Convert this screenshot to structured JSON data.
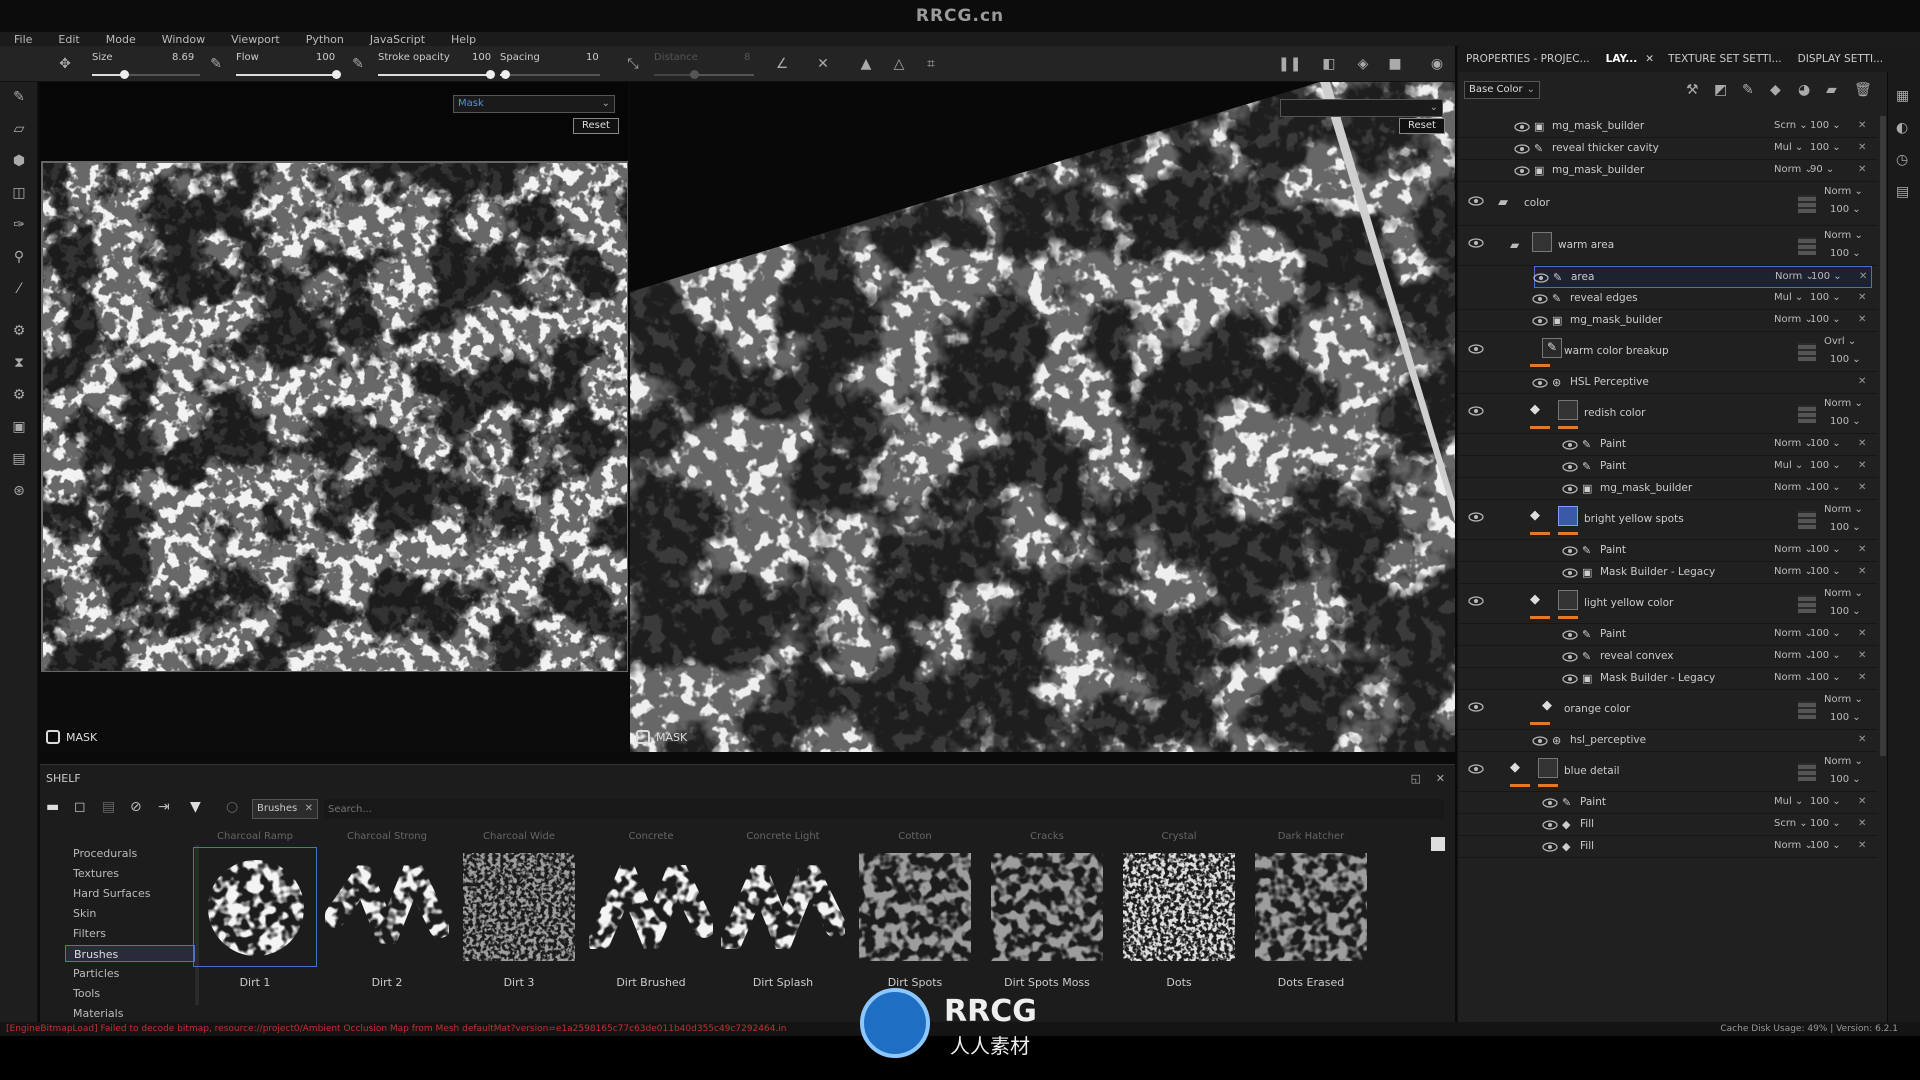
{
  "brand": "RRCG.cn",
  "menu": [
    "File",
    "Edit",
    "Mode",
    "Window",
    "Viewport",
    "Python",
    "JavaScript",
    "Help"
  ],
  "toolbar": {
    "size_label": "Size",
    "size_value": "8.69",
    "size_fraction": 0.3,
    "flow_label": "Flow",
    "flow_value": "100",
    "flow_fraction": 1.0,
    "opacity_label": "Stroke opacity",
    "opacity_value": "100",
    "opacity_fraction": 1.0,
    "spacing_label": "Spacing",
    "spacing_value": "10",
    "spacing_fraction": 0.05,
    "distance_label": "Distance",
    "distance_value": "8",
    "distance_fraction": 0.4
  },
  "viewport2d": {
    "channel": "Mask",
    "reset": "Reset",
    "label": "MASK"
  },
  "viewport3d": {
    "channel": "",
    "reset": "Reset",
    "label": "MASK"
  },
  "shelf": {
    "title": "SHELF",
    "filter_tag": "Brushes",
    "search_placeholder": "Search...",
    "categories": [
      "Procedurals",
      "Textures",
      "Hard Surfaces",
      "Skin",
      "Filters",
      "Brushes",
      "Particles",
      "Tools",
      "Materials"
    ],
    "active_category": "Brushes",
    "thumbs_top": [
      "Charcoal Ramp",
      "Charcoal Strong",
      "Charcoal Wide",
      "Concrete",
      "Concrete Light",
      "Cotton",
      "Cracks",
      "Crystal",
      "Dark Hatcher"
    ],
    "thumbs": [
      "Dirt 1",
      "Dirt 2",
      "Dirt 3",
      "Dirt Brushed",
      "Dirt Splash",
      "Dirt Spots",
      "Dirt Spots Moss",
      "Dots",
      "Dots Erased"
    ]
  },
  "status": {
    "error": "[EngineBitmapLoad] Failed to decode bitmap, resource://project0/Ambient Occlusion Map from Mesh defaultMat?version=e1a2598165c77c63de011b40d355c49c7292464.in",
    "right": "Cache Disk Usage:    49% | Version: 6.2.1"
  },
  "panel": {
    "tabs": [
      "PROPERTIES - PROJEC...",
      "LAY...",
      "TEXTURE SET SETTI...",
      "DISPLAY SETTI..."
    ],
    "channel": "Base Color",
    "layers": [
      {
        "name": "mg_mask_builder",
        "blend": "Scrn",
        "opacity": "100"
      },
      {
        "name": "reveal thicker cavity",
        "blend": "Mul",
        "opacity": "100"
      },
      {
        "name": "mg_mask_builder",
        "blend": "Norm",
        "opacity": "90"
      },
      {
        "name": "color",
        "blend": "Norm",
        "opacity": "100"
      },
      {
        "name": "warm area",
        "blend": "Norm",
        "opacity": "100"
      },
      {
        "name": "area",
        "blend": "Norm",
        "opacity": "100"
      },
      {
        "name": "reveal edges",
        "blend": "Mul",
        "opacity": "100"
      },
      {
        "name": "mg_mask_builder",
        "blend": "Norm",
        "opacity": "100"
      },
      {
        "name": "warm color breakup",
        "blend": "Ovrl",
        "opacity": "100"
      },
      {
        "name": "HSL Perceptive",
        "blend": "",
        "opacity": ""
      },
      {
        "name": "redish color",
        "blend": "Norm",
        "opacity": "100"
      },
      {
        "name": "Paint",
        "blend": "Norm",
        "opacity": "100"
      },
      {
        "name": "Paint",
        "blend": "Mul",
        "opacity": "100"
      },
      {
        "name": "mg_mask_builder",
        "blend": "Norm",
        "opacity": "100"
      },
      {
        "name": "bright yellow spots",
        "blend": "Norm",
        "opacity": "100"
      },
      {
        "name": "Paint",
        "blend": "Norm",
        "opacity": "100"
      },
      {
        "name": "Mask Builder - Legacy",
        "blend": "Norm",
        "opacity": "100"
      },
      {
        "name": "light yellow color",
        "blend": "Norm",
        "opacity": "100"
      },
      {
        "name": "Paint",
        "blend": "Norm",
        "opacity": "100"
      },
      {
        "name": "reveal convex",
        "blend": "Norm",
        "opacity": "100"
      },
      {
        "name": "Mask Builder - Legacy",
        "blend": "Norm",
        "opacity": "100"
      },
      {
        "name": "orange color",
        "blend": "Norm",
        "opacity": "100"
      },
      {
        "name": "hsl_perceptive",
        "blend": "",
        "opacity": ""
      },
      {
        "name": "blue detail",
        "blend": "Norm",
        "opacity": "100"
      },
      {
        "name": "Paint",
        "blend": "Mul",
        "opacity": "100"
      },
      {
        "name": "Fill",
        "blend": "Scrn",
        "opacity": "100"
      },
      {
        "name": "Fill",
        "blend": "Norm",
        "opacity": "100"
      }
    ]
  },
  "watermark": {
    "logo_text": "RRCG",
    "sub_text": "人人素材"
  }
}
